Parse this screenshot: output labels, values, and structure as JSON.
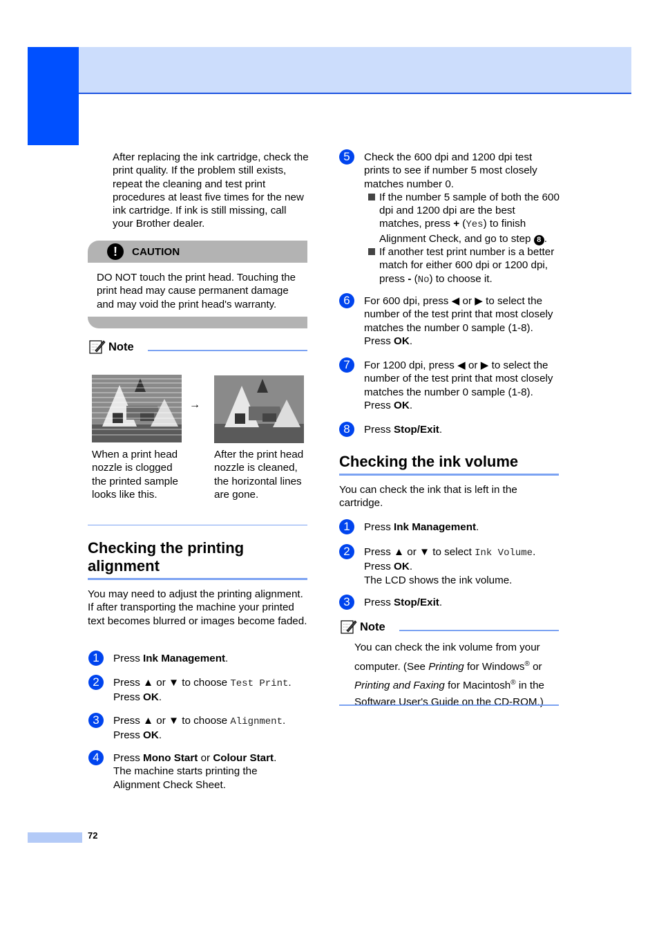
{
  "intro": "After replacing the ink cartridge, check the print quality. If the problem still exists, repeat the cleaning and test print procedures at least five times for the new ink cartridge. If ink is still missing, call your Brother dealer.",
  "caution": {
    "label": "CAUTION",
    "icon": "exclamation-icon",
    "body": "DO NOT touch the print head. Touching the print head may cause permanent damage and may void the print head's warranty."
  },
  "note1": {
    "label": "Note",
    "arrow": "→",
    "before_caption": "When a print head nozzle is clogged the printed sample looks like this.",
    "after_caption": "After the print head nozzle is cleaned, the horizontal lines are gone."
  },
  "alignment": {
    "title": "Checking the printing alignment",
    "intro": "You may need to adjust the printing alignment. If after transporting the machine your printed text becomes blurred or images become faded.",
    "steps": [
      {
        "n": "1",
        "pre": "Press ",
        "bold": "Ink Management",
        "post": "."
      },
      {
        "n": "2",
        "pre": "Press ▲ or ▼ to choose ",
        "mono": "Test Print",
        "post": ".",
        "line2_pre": "Press ",
        "line2_bold": "OK",
        "line2_post": "."
      },
      {
        "n": "3",
        "pre": "Press ▲ or ▼ to choose ",
        "mono": "Alignment",
        "post": ".",
        "line2_pre": "Press ",
        "line2_bold": "OK",
        "line2_post": "."
      },
      {
        "n": "4",
        "pre": "Press ",
        "bold": "Mono Start",
        "mid": " or ",
        "bold2": "Colour Start",
        "post": ".",
        "line2": "The machine starts printing the Alignment Check Sheet."
      },
      {
        "n": "5",
        "text": "Check the 600 dpi and 1200 dpi test prints to see if number 5 most closely matches number 0.",
        "bullets": [
          {
            "pre": "If the number 5 sample of both the 600 dpi and 1200 dpi are the best matches, press ",
            "key": "+",
            "paren_open": " (",
            "mono": "Yes",
            "paren_close": ")",
            "post": " to finish Alignment Check, and go to step ",
            "ref": "8",
            "end": "."
          },
          {
            "pre": "If another test print number is a better match for either 600 dpi or 1200 dpi, press ",
            "key": "-",
            "paren_open": " (",
            "mono": "No",
            "paren_close": ")",
            "post": " to choose it."
          }
        ]
      },
      {
        "n": "6",
        "text": "For 600 dpi, press ◀ or ▶ to select the number of the test print that most closely matches the number 0 sample (1-8).",
        "line2_pre": "Press ",
        "line2_bold": "OK",
        "line2_post": "."
      },
      {
        "n": "7",
        "text": "For 1200 dpi, press ◀ or ▶ to select the number of the test print that most closely matches the number 0 sample (1-8).",
        "line2_pre": "Press ",
        "line2_bold": "OK",
        "line2_post": "."
      },
      {
        "n": "8",
        "pre": "Press ",
        "bold": "Stop/Exit",
        "post": "."
      }
    ]
  },
  "ink_volume": {
    "title": "Checking the ink volume",
    "intro": "You can check the ink that is left in the cartridge.",
    "steps": [
      {
        "n": "1",
        "pre": "Press ",
        "bold": "Ink Management",
        "post": "."
      },
      {
        "n": "2",
        "pre": "Press ▲ or ▼ to select ",
        "mono": "Ink Volume",
        "post": ".",
        "line2_pre": "Press ",
        "line2_bold": "OK",
        "line2_post": ".",
        "line3": "The LCD shows the ink volume."
      },
      {
        "n": "3",
        "pre": "Press ",
        "bold": "Stop/Exit",
        "post": "."
      }
    ],
    "note": {
      "label": "Note",
      "t1": "You can check the ink volume from your computer. (See ",
      "i1": "Printing",
      "t2": " for Windows",
      "reg": "®",
      "t3": " or ",
      "i2": "Printing and Faxing",
      "t4": " for Macintosh",
      "t5": " in the Software User's Guide on the CD-ROM.)"
    }
  },
  "footer": {
    "page_number": "72"
  }
}
